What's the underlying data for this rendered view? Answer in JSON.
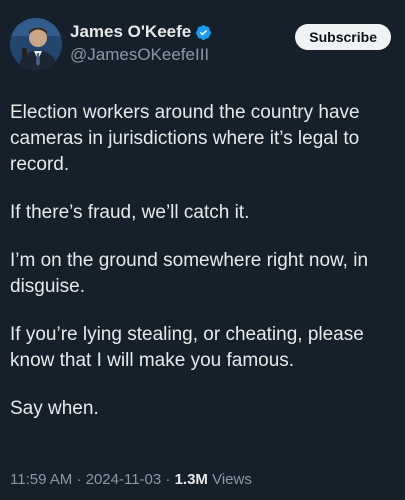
{
  "author": {
    "name": "James O'Keefe",
    "handle": "@JamesOKeefeIII",
    "verified": true,
    "verified_color": "#1d9bf0"
  },
  "actions": {
    "subscribe_label": "Subscribe"
  },
  "tweet": {
    "paragraphs": [
      "Election workers around the country have cameras in jurisdictions where it’s legal to record.",
      "If there’s fraud, we’ll catch it.",
      "I’m on the ground somewhere right now, in disguise.",
      "If you’re lying stealing, or cheating, please know that I will make you famous.",
      "Say when."
    ]
  },
  "meta": {
    "time": "11:59 AM",
    "separator": "·",
    "date": "2024-11-03",
    "views_count": "1.3M",
    "views_label": "Views"
  },
  "colors": {
    "background": "#15202b",
    "text": "#e7e9ea",
    "secondary_text": "#8b98a5"
  }
}
